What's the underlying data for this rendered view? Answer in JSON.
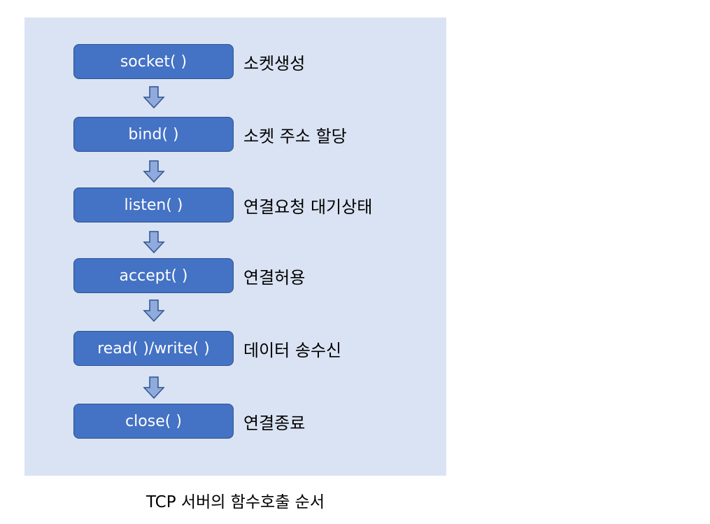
{
  "steps": [
    {
      "func": "socket( )",
      "desc": "소켓생성"
    },
    {
      "func": "bind( )",
      "desc": "소켓 주소 할당"
    },
    {
      "func": "listen( )",
      "desc": "연결요청 대기상태"
    },
    {
      "func": "accept( )",
      "desc": "연결허용"
    },
    {
      "func": "read( )/write( )",
      "desc": "데이터 송수신"
    },
    {
      "func": "close( )",
      "desc": "연결종료"
    }
  ],
  "caption": "TCP 서버의 함수호출 순서",
  "colors": {
    "background": "#DAE3F3",
    "box": "#4472C4",
    "border": "#2F528F",
    "arrow": "#8FAADC"
  }
}
